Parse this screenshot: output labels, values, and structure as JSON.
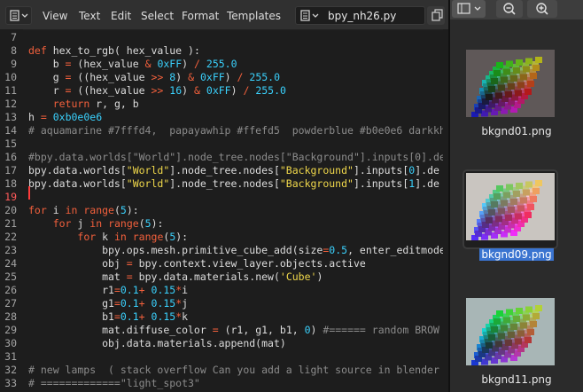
{
  "editor": {
    "menu": {
      "view": "View",
      "text": "Text",
      "edit": "Edit",
      "select": "Select",
      "format": "Format",
      "templates": "Templates"
    },
    "file_name": "bpy_nh26.py",
    "line_numbers": [
      "7",
      "8",
      "9",
      "10",
      "11",
      "12",
      "13",
      "14",
      "15",
      "16",
      "17",
      "18",
      "19",
      "20",
      "21",
      "22",
      "23",
      "24",
      "25",
      "26",
      "27",
      "28",
      "29",
      "30",
      "31",
      "32",
      "33"
    ],
    "current_line": "19",
    "code_lines": [
      "",
      "def hex_to_rgb( hex_value ):",
      "    b = (hex_value & 0xFF) / 255.0",
      "    g = ((hex_value >> 8) & 0xFF) / 255.0",
      "    r = ((hex_value >> 16) & 0xFF) / 255.0",
      "    return r, g, b",
      "h = 0xb0e0e6",
      "# aquamarine #7fffd4,  papayawhip #ffefd5  powderblue #b0e0e6 darkkh",
      "",
      "#bpy.data.worlds[\"World\"].node_tree.nodes[\"Background\"].inputs[0].de",
      "bpy.data.worlds[\"World\"].node_tree.nodes[\"Background\"].inputs[0].de",
      "bpy.data.worlds[\"World\"].node_tree.nodes[\"Background\"].inputs[1].de",
      "",
      "for i in range(5):",
      "    for j in range(5):",
      "        for k in range(5):",
      "            bpy.ops.mesh.primitive_cube_add(size=0.5, enter_editmode",
      "            obj = bpy.context.view_layer.objects.active",
      "            mat = bpy.data.materials.new('Cube')",
      "            r1=0.1+ 0.15*i",
      "            g1=0.1+ 0.15*j",
      "            b1=0.1+ 0.15*k",
      "            mat.diffuse_color = (r1, g1, b1, 0) #====== random BROW",
      "            obj.data.materials.append(mat)",
      "",
      "# new lamps  ( stack overflow Can you add a light source in blender",
      "# =============\"light_spot3\""
    ]
  },
  "browser": {
    "files": [
      {
        "name": "bkgnd01.png",
        "selected": false
      },
      {
        "name": "bkgnd09.png",
        "selected": true
      },
      {
        "name": "bkgnd11.png",
        "selected": false
      }
    ]
  },
  "colors": {
    "keyword": "#f2603c",
    "number": "#3ad1fd",
    "string": "#f0d84b",
    "comment": "#8c8c8c",
    "selection": "#3a74d0"
  }
}
